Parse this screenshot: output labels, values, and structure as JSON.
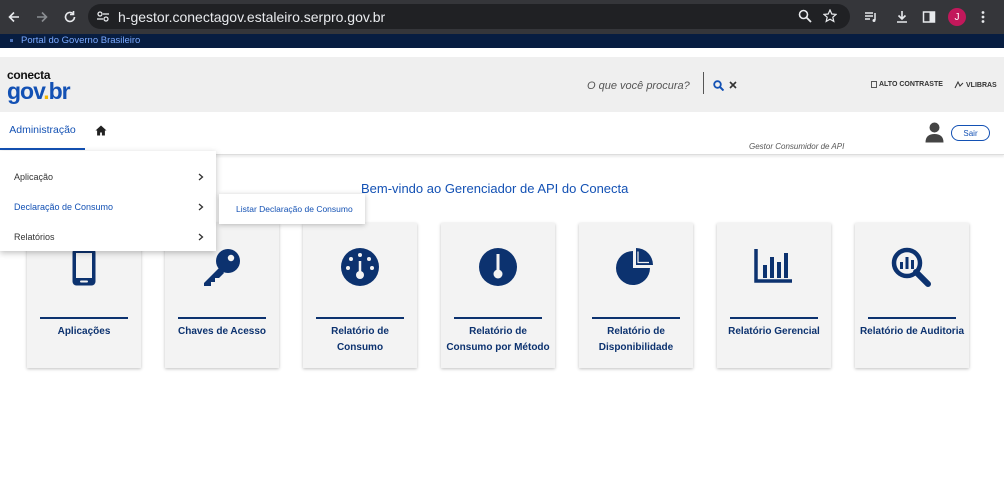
{
  "browser": {
    "url": "h-gestor.conectagov.estaleiro.serpro.gov.br",
    "profile_initial": "J"
  },
  "govbar": {
    "label": "Portal do Governo Brasileiro"
  },
  "header": {
    "logo_top": "conecta",
    "logo_bottom_a": "gov",
    "logo_bottom_dot": ".",
    "logo_bottom_b": "br",
    "search_placeholder": "O que você procura?",
    "alto_contraste": "ALTO CONTRASTE",
    "vlibras": "VLIBRAS"
  },
  "nav": {
    "admin_label": "Administração",
    "role": "Gestor Consumidor de API",
    "sair_label": "Sair"
  },
  "menu": {
    "items": [
      {
        "label": "Aplicação"
      },
      {
        "label": "Declaração de Consumo"
      },
      {
        "label": "Relatórios"
      }
    ],
    "submenu_item": "Listar Declaração de Consumo"
  },
  "main": {
    "welcome": "Bem-vindo ao Gerenciador de API do Conecta",
    "cards": [
      {
        "label": "Aplicações",
        "icon": "mobile-icon"
      },
      {
        "label": "Chaves de Acesso",
        "icon": "key-icon"
      },
      {
        "label": "Relatório de Consumo",
        "icon": "gauge-icon"
      },
      {
        "label": "Relatório de Consumo por Método",
        "icon": "thermometer-icon"
      },
      {
        "label": "Relatório de Disponibilidade",
        "icon": "pie-chart-icon"
      },
      {
        "label": "Relatório Gerencial",
        "icon": "bar-chart-icon"
      },
      {
        "label": "Relatório de Auditoria",
        "icon": "search-chart-icon"
      }
    ]
  },
  "colors": {
    "primary": "#1351b4",
    "dark": "#0c326f",
    "govbar": "#071d41"
  }
}
